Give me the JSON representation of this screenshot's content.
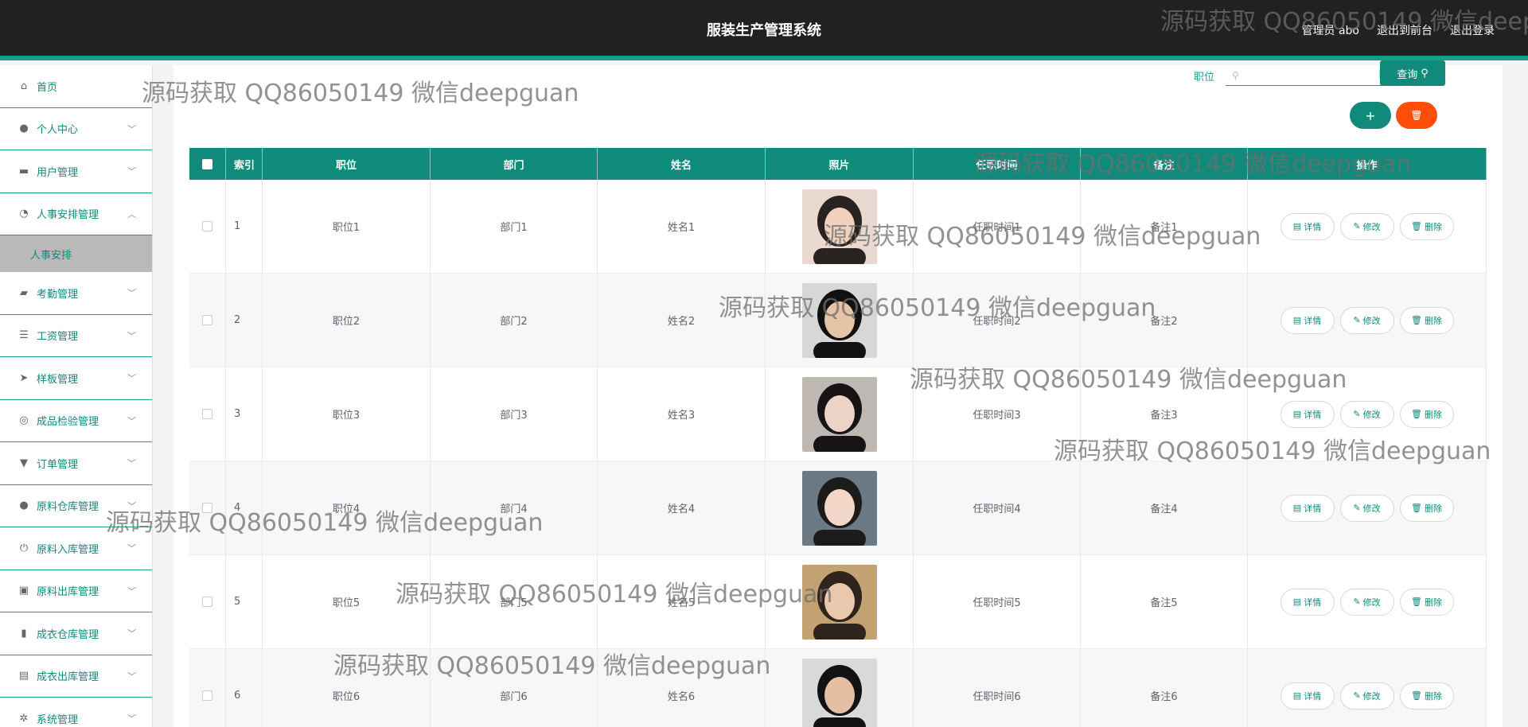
{
  "header": {
    "title": "服装生产管理系统",
    "admin": "管理员 abo",
    "to_front": "退出到前台",
    "logout": "退出登录"
  },
  "sidebar": {
    "items": [
      {
        "label": "首页",
        "icon": "home-icon"
      },
      {
        "label": "个人中心",
        "icon": "user-icon"
      },
      {
        "label": "用户管理",
        "icon": "users-icon"
      },
      {
        "label": "人事安排管理",
        "icon": "gauge-icon"
      },
      {
        "label": "考勤管理",
        "icon": "chat-icon"
      },
      {
        "label": "工资管理",
        "icon": "list-icon"
      },
      {
        "label": "样板管理",
        "icon": "send-icon"
      },
      {
        "label": "成品检验管理",
        "icon": "target-icon"
      },
      {
        "label": "订单管理",
        "icon": "stamp-icon"
      },
      {
        "label": "原料仓库管理",
        "icon": "user-icon"
      },
      {
        "label": "原料入库管理",
        "icon": "power-icon"
      },
      {
        "label": "原料出库管理",
        "icon": "box-icon"
      },
      {
        "label": "成衣仓库管理",
        "icon": "chart-icon"
      },
      {
        "label": "成衣出库管理",
        "icon": "clipboard-icon"
      },
      {
        "label": "系统管理",
        "icon": "gear-icon"
      }
    ],
    "sub_item": "人事安排"
  },
  "search": {
    "label": "职位",
    "placeholder": "职位",
    "query_button": "查询"
  },
  "table": {
    "headers": [
      "索引",
      "职位",
      "部门",
      "姓名",
      "照片",
      "任职时间",
      "备注",
      "操作"
    ],
    "rows": [
      {
        "idx": "1",
        "pos": "职位1",
        "dept": "部门1",
        "name": "姓名1",
        "time": "任职时间1",
        "note": "备注1"
      },
      {
        "idx": "2",
        "pos": "职位2",
        "dept": "部门2",
        "name": "姓名2",
        "time": "任职时间2",
        "note": "备注2"
      },
      {
        "idx": "3",
        "pos": "职位3",
        "dept": "部门3",
        "name": "姓名3",
        "time": "任职时间3",
        "note": "备注3"
      },
      {
        "idx": "4",
        "pos": "职位4",
        "dept": "部门4",
        "name": "姓名4",
        "time": "任职时间4",
        "note": "备注4"
      },
      {
        "idx": "5",
        "pos": "职位5",
        "dept": "部门5",
        "name": "姓名5",
        "time": "任职时间5",
        "note": "备注5"
      },
      {
        "idx": "6",
        "pos": "职位6",
        "dept": "部门6",
        "name": "姓名6",
        "time": "任职时间6",
        "note": "备注6"
      }
    ],
    "ops": {
      "detail": "详情",
      "edit": "修改",
      "delete": "删除"
    }
  },
  "watermark": "源码获取 QQ86050149 微信deepguan",
  "colors": {
    "primary": "#0f8a7b",
    "danger": "#ff4d0a",
    "header_bg": "#212121"
  }
}
